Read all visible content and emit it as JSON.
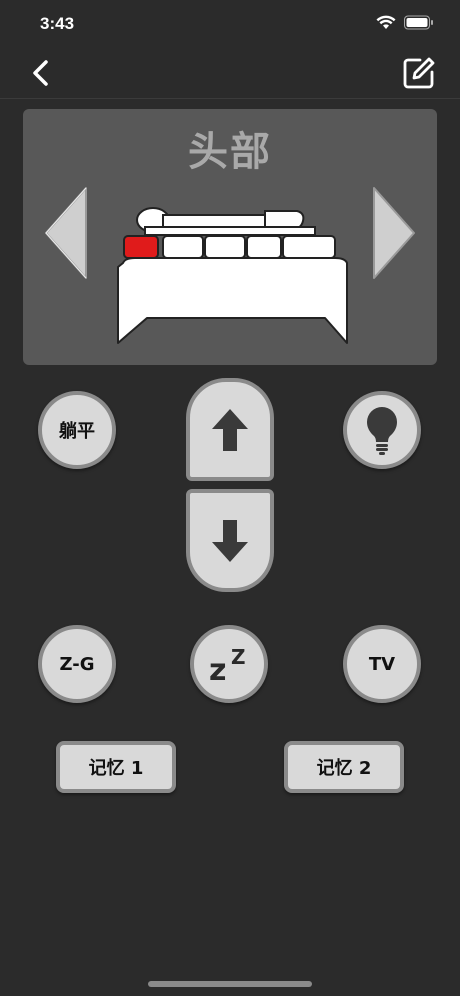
{
  "status_bar": {
    "time": "3:43"
  },
  "nav": {
    "back_icon": "chevron-left-icon",
    "edit_icon": "edit-square-icon"
  },
  "panel": {
    "title": "头部",
    "selected_segment_color": "#e01b1b",
    "segments_count": 5,
    "selected_segment_index": 0
  },
  "buttons": {
    "flat_label": "躺平",
    "zg_label": "Z-G",
    "zz_label": "zz",
    "tv_label": "TV",
    "memory1_label": "记忆 1",
    "memory2_label": "记忆 2",
    "light_icon": "lightbulb-icon",
    "up_icon": "arrow-up-icon",
    "down_icon": "arrow-down-icon"
  },
  "colors": {
    "background": "#2b2b2b",
    "panel": "#585858",
    "button_fill": "#d9d9d9",
    "button_border": "#8a8a8a"
  }
}
